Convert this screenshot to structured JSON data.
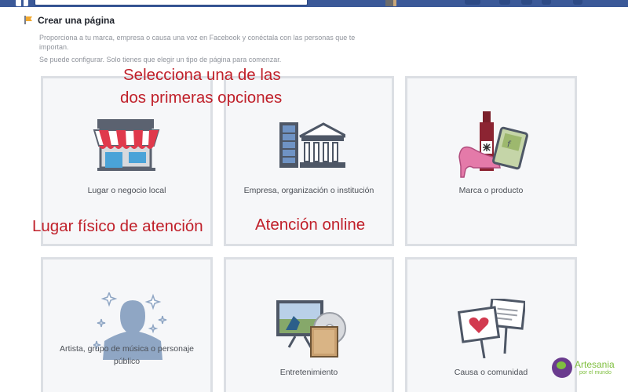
{
  "header": {
    "title": "Crear una página",
    "intro": "Proporciona a tu marca, empresa o causa una voz en Facebook y conéctala con las personas que te importan.",
    "hint": "Se puede configurar. Solo tienes que elegir un tipo de página para comenzar."
  },
  "categories": [
    {
      "label": "Lugar o negocio local",
      "icon": "storefront-icon"
    },
    {
      "label": "Empresa, organización o institución",
      "icon": "office-building-icon"
    },
    {
      "label": "Marca o producto",
      "icon": "products-icon"
    },
    {
      "label": "Artista, grupo de música o personaje público",
      "icon": "person-silhouette-icon"
    },
    {
      "label": "Entretenimiento",
      "icon": "tv-media-icon"
    },
    {
      "label": "Causa o comunidad",
      "icon": "protest-signs-icon"
    }
  ],
  "annotations": {
    "select_line1": "Selecciona una de las",
    "select_line2": "dos primeras opciones",
    "physical": "Lugar físico de atención",
    "online": "Atención online"
  },
  "watermark": {
    "brand": "Artesania",
    "tagline": "por el mundo"
  },
  "colors": {
    "facebook_blue": "#3b5998",
    "annotation_red": "#c0202a",
    "card_bg": "#f6f7f9",
    "card_border": "#dcdfe4"
  }
}
